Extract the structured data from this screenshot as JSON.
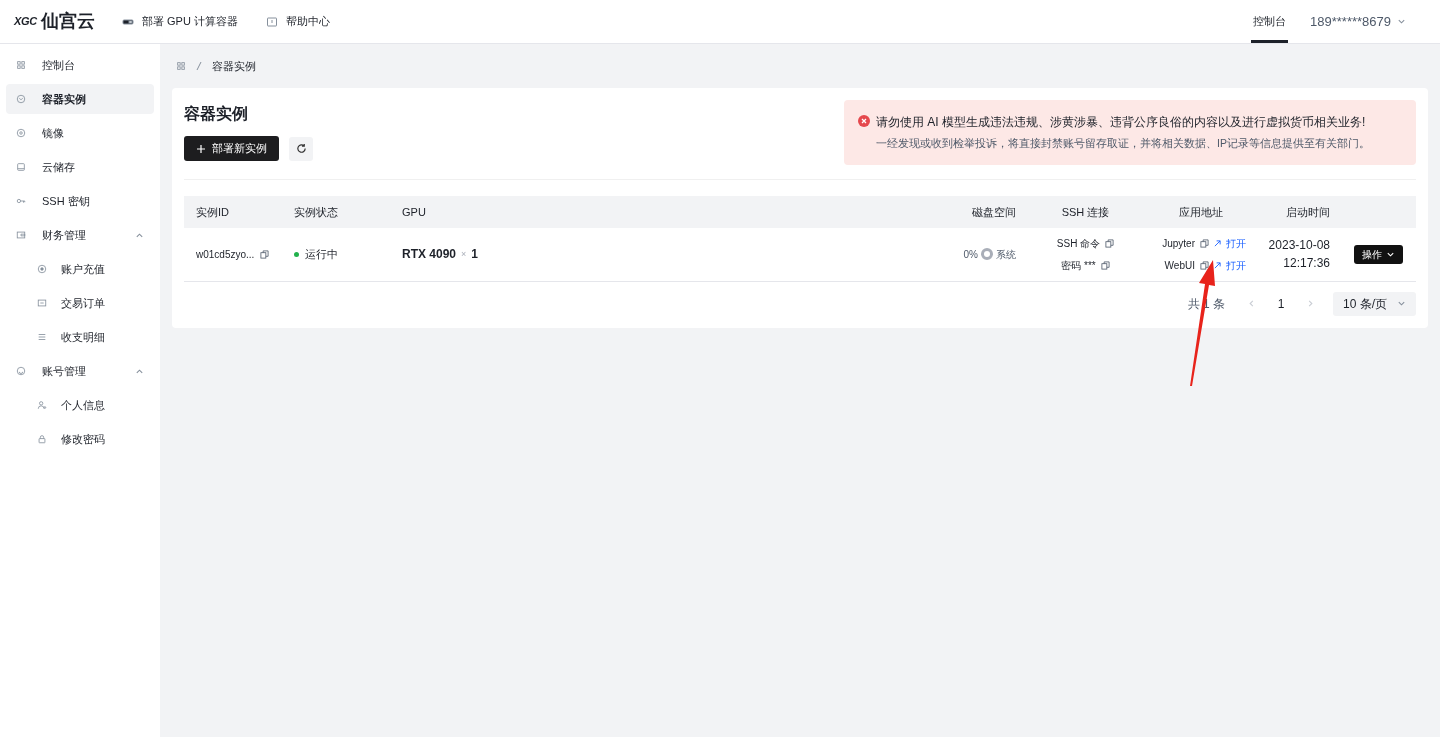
{
  "header": {
    "logo_mark": "XGC",
    "logo_text": "仙宫云",
    "nav": [
      {
        "label": "部署 GPU 计算容器"
      },
      {
        "label": "帮助中心"
      }
    ],
    "tabs": [
      {
        "label": "控制台",
        "selected": true
      }
    ],
    "user": "189******8679"
  },
  "sidebar": {
    "items": [
      {
        "label": "控制台",
        "selected": false
      },
      {
        "label": "容器实例",
        "selected": true
      },
      {
        "label": "镜像",
        "selected": false
      },
      {
        "label": "云储存",
        "selected": false
      },
      {
        "label": "SSH 密钥",
        "selected": false
      },
      {
        "label": "财务管理",
        "selected": false,
        "expanded": true,
        "children": [
          {
            "label": "账户充值",
            "selected": false
          },
          {
            "label": "交易订单",
            "selected": false
          },
          {
            "label": "收支明细",
            "selected": false
          }
        ]
      },
      {
        "label": "账号管理",
        "selected": false,
        "expanded": true,
        "children": [
          {
            "label": "个人信息",
            "selected": false
          },
          {
            "label": "修改密码",
            "selected": false
          }
        ]
      }
    ]
  },
  "breadcrumb": [
    "容器实例"
  ],
  "page": {
    "title": "容器实例",
    "deploy_button": "部署新实例"
  },
  "alert": {
    "title": "请勿使用 AI 模型生成违法违规、涉黄涉暴、违背公序良俗的内容以及进行虚拟货币相关业务!",
    "text": "一经发现或收到检举投诉，将直接封禁账号留存取证，并将相关数据、IP记录等信息提供至有关部门。"
  },
  "table": {
    "columns": [
      "实例ID",
      "实例状态",
      "GPU",
      "磁盘空间",
      "SSH 连接",
      "应用地址",
      "启动时间"
    ],
    "rows": [
      {
        "id": "w01cd5zyo...",
        "status": "运行中",
        "gpu_model": "RTX 4090",
        "gpu_times": "×",
        "gpu_count": "1",
        "disk_percent": "0%",
        "disk_label": "系统",
        "ssh": [
          "SSH 命令",
          "密码 ***"
        ],
        "apps": [
          {
            "name": "Jupyter",
            "link": "打开"
          },
          {
            "name": "WebUI",
            "link": "打开"
          }
        ],
        "start_date": "2023-10-08",
        "start_time": "12:17:36",
        "action": "操作"
      }
    ]
  },
  "pagination": {
    "total": "共 1 条",
    "pages": [
      {
        "label": "1",
        "selected": true
      }
    ],
    "page_size": "10 条/页"
  }
}
